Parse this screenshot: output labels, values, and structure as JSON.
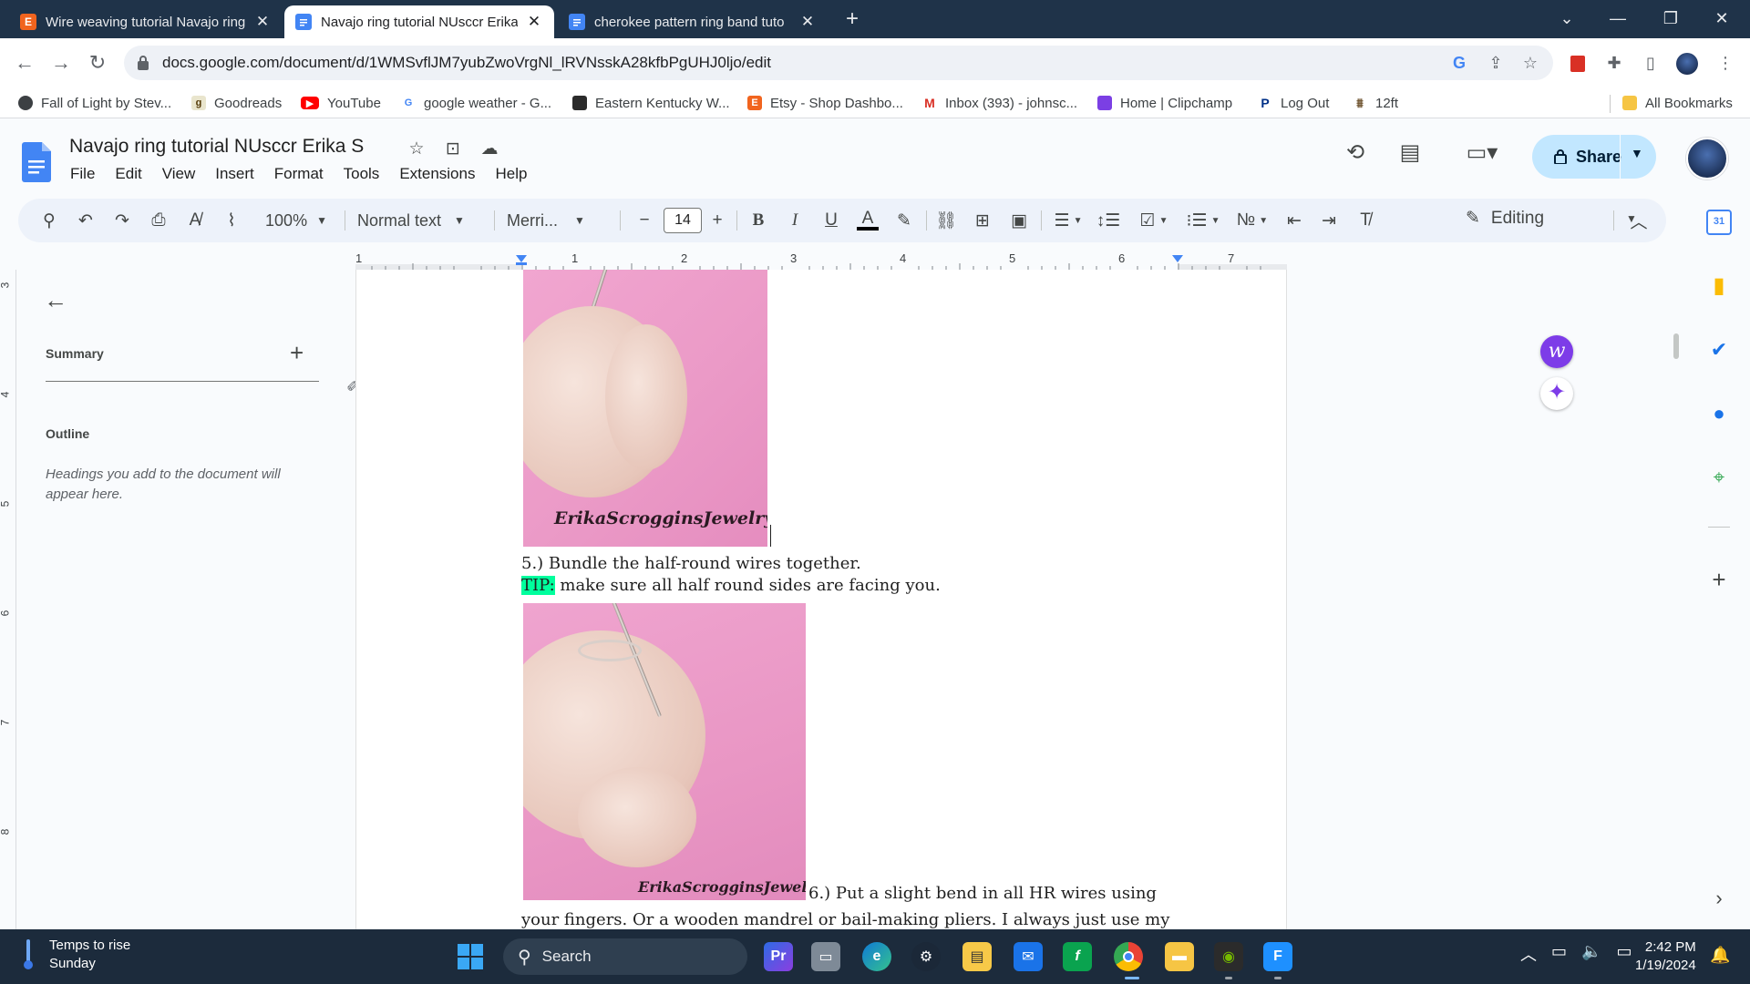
{
  "tabs": [
    {
      "title": "Wire weaving tutorial Navajo ring",
      "favicon": "etsy-icon",
      "favicon_text": "E"
    },
    {
      "title": "Navajo ring tutorial NUsccr Erika",
      "favicon": "docs-icon",
      "active": true
    },
    {
      "title": "cherokee pattern ring band tuto",
      "favicon": "docs-icon"
    }
  ],
  "browser": {
    "url": "docs.google.com/document/d/1WMSvflJM7yubZwoVrgNl_lRVNsskA28kfbPgUHJ0ljo/edit"
  },
  "bookmarks": [
    {
      "label": "Fall of Light by Stev...",
      "icon": "goodreads-style-icon"
    },
    {
      "label": "Goodreads",
      "icon": "goodreads-icon",
      "icon_text": "g"
    },
    {
      "label": "YouTube",
      "icon": "youtube-icon"
    },
    {
      "label": "google weather - G...",
      "icon": "google-icon",
      "icon_text": "G"
    },
    {
      "label": "Eastern Kentucky W...",
      "icon": "bookmark-icon"
    },
    {
      "label": "Etsy - Shop Dashbo...",
      "icon": "etsy-icon",
      "icon_text": "E"
    },
    {
      "label": "Inbox (393) - johnsc...",
      "icon": "gmail-icon"
    },
    {
      "label": "Home | Clipchamp",
      "icon": "clipchamp-icon"
    },
    {
      "label": "Log Out",
      "icon": "paypal-icon",
      "icon_text": "P"
    },
    {
      "label": "12ft",
      "icon": "ladder-icon"
    }
  ],
  "all_bookmarks": "All Bookmarks",
  "doc": {
    "title": "Navajo ring tutorial NUsccr Erika S",
    "menu": [
      "File",
      "Edit",
      "View",
      "Insert",
      "Format",
      "Tools",
      "Extensions",
      "Help"
    ],
    "share_label": "Share"
  },
  "toolbar": {
    "zoom": "100%",
    "style": "Normal text",
    "font": "Merri...",
    "font_size": "14",
    "mode": "Editing"
  },
  "ruler": {
    "numbers": [
      "1",
      "1",
      "2",
      "3",
      "4",
      "5",
      "6",
      "7"
    ]
  },
  "vruler": {
    "numbers": [
      "3",
      "4",
      "5",
      "6",
      "7",
      "8"
    ]
  },
  "outline": {
    "summary_label": "Summary",
    "outline_label": "Outline",
    "hint": "Headings you add to the document will appear here."
  },
  "content": {
    "watermark": "ErikaScrogginsJewelry",
    "step5": "5.) Bundle the half-round wires together.",
    "tip_label": "TIP:",
    "tip_text": " make sure all half round sides are facing you.",
    "step6_line1": "6.) Put a slight bend in all HR wires using",
    "step6_line2": "your fingers. Or a wooden mandrel or bail-making pliers. I always just use my"
  },
  "taskbar": {
    "weather_line1": "Temps to rise",
    "weather_line2": "Sunday",
    "search_label": "Search",
    "time": "2:42 PM",
    "date": "1/19/2024"
  }
}
